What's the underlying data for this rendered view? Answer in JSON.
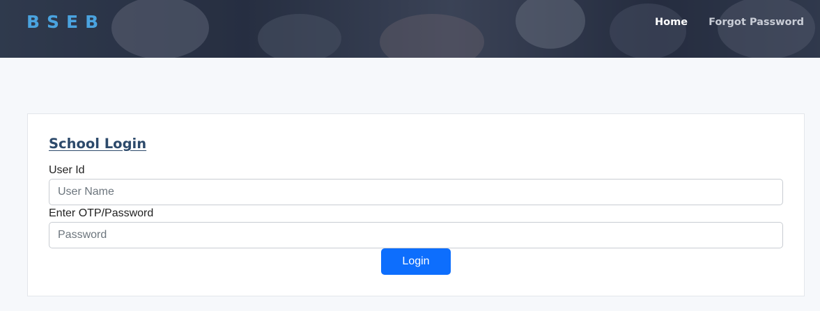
{
  "header": {
    "brand": "BSEB",
    "nav": {
      "home": "Home",
      "forgot_password": "Forgot Password"
    }
  },
  "login_form": {
    "title": "School Login",
    "user_id_label": "User Id",
    "user_id_placeholder": "User Name",
    "user_id_value": "",
    "password_label": "Enter OTP/Password",
    "password_placeholder": "Password",
    "password_value": "",
    "submit_label": "Login"
  },
  "colors": {
    "brand": "#4aa3df",
    "primary_button": "#0d6efd",
    "title": "#2d4a6b",
    "page_background": "#f6f8fb"
  }
}
